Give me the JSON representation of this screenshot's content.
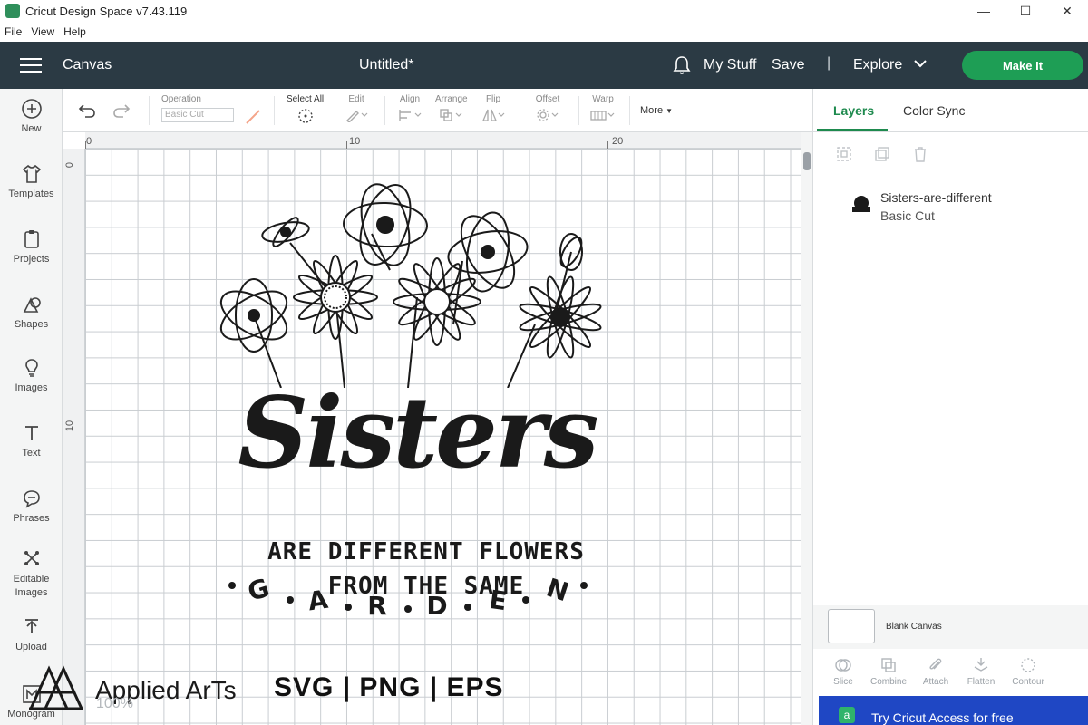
{
  "window": {
    "title": "Cricut Design Space  v7.43.119",
    "controls": [
      "—",
      "☐",
      "✕"
    ]
  },
  "menu": [
    "File",
    "View",
    "Help"
  ],
  "header": {
    "canvas_label": "Canvas",
    "doc_title": "Untitled*",
    "my_stuff": "My Stuff",
    "save": "Save",
    "separator": "|",
    "explore": "Explore",
    "make_it": "Make It",
    "make_it_color": "#1e9e55",
    "bar_color": "#2b3a44"
  },
  "sidebar": {
    "items": [
      {
        "label": "New",
        "icon": "plus-circle-icon"
      },
      {
        "label": "Templates",
        "icon": "shirt-icon"
      },
      {
        "label": "Projects",
        "icon": "clipboard-icon"
      },
      {
        "label": "Shapes",
        "icon": "shapes-icon"
      },
      {
        "label": "Images",
        "icon": "lightbulb-icon"
      },
      {
        "label": "Text",
        "icon": "text-icon"
      },
      {
        "label": "Phrases",
        "icon": "speech-bubble-icon"
      },
      {
        "label": "Editable Images",
        "icon": "editable-images-icon"
      },
      {
        "label": "Upload",
        "icon": "upload-icon"
      },
      {
        "label": "Monogram",
        "icon": "monogram-icon"
      }
    ]
  },
  "toolbar": {
    "operation_label": "Operation",
    "operation_value": "Basic Cut",
    "select_all": "Select All",
    "edit": "Edit",
    "align": "Align",
    "arrange": "Arrange",
    "flip": "Flip",
    "offset": "Offset",
    "warp": "Warp",
    "more": "More"
  },
  "ruler": {
    "top_ticks": [
      "0",
      "10",
      "20"
    ],
    "left_ticks": [
      "0",
      "10"
    ]
  },
  "design": {
    "title_word": "Sisters",
    "line1": "ARE DIFFERENT FLOWERS",
    "line2": "FROM THE SAME",
    "garden_letters": [
      "G",
      "A",
      "R",
      "D",
      "E",
      "N"
    ]
  },
  "panel": {
    "tab_layers": "Layers",
    "tab_color_sync": "Color Sync",
    "layer_name": "Sisters-are-different",
    "layer_operation": "Basic Cut",
    "blank_canvas": "Blank Canvas",
    "actions": [
      "Slice",
      "Combine",
      "Attach",
      "Flatten",
      "Contour"
    ],
    "access_banner": "Try Cricut Access for free",
    "accent_color": "#1e8a4e"
  },
  "overlay": {
    "brand_name": "Applied ArTs",
    "formats": "SVG | PNG | EPS",
    "zoom": "100%"
  }
}
